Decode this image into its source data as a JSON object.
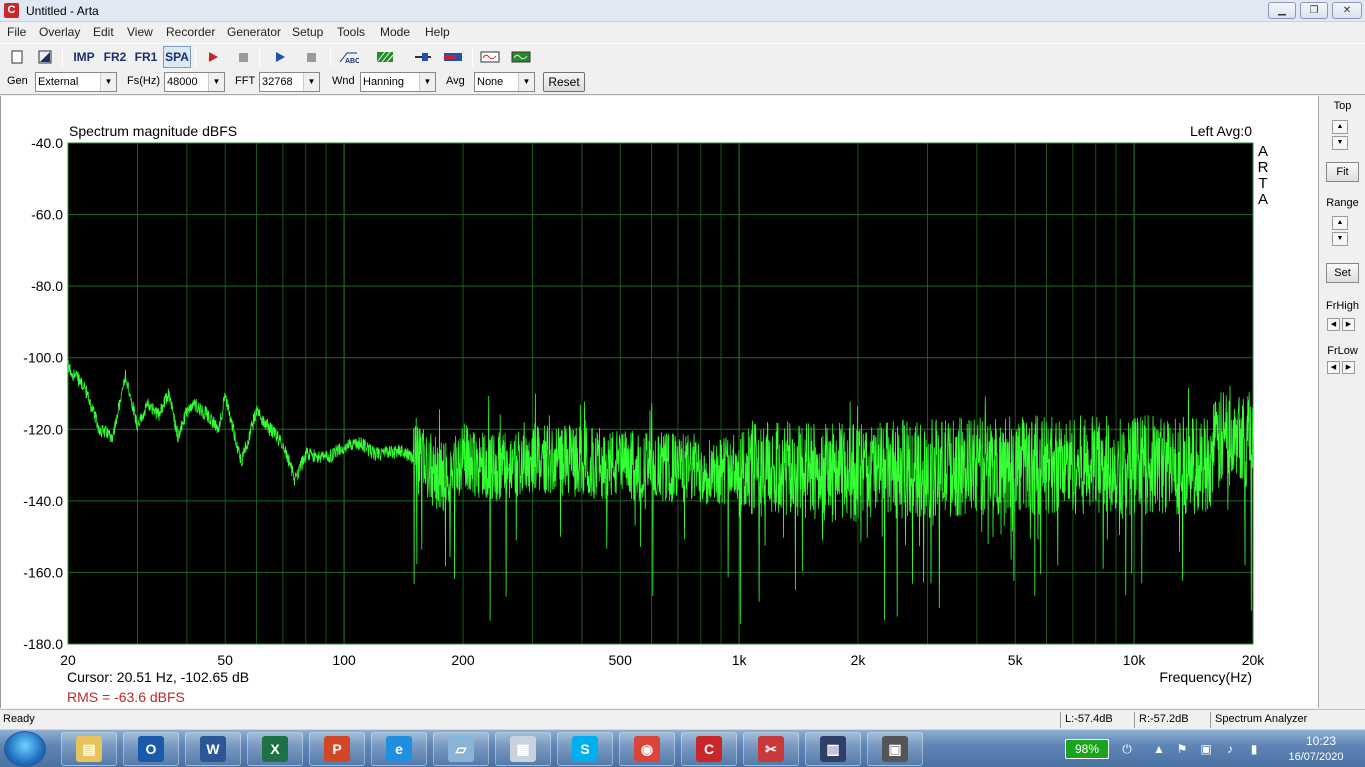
{
  "window": {
    "title": "Untitled - Arta",
    "icon_letter": "C"
  },
  "menu": [
    "File",
    "Overlay",
    "Edit",
    "View",
    "Recorder",
    "Generator",
    "Setup",
    "Tools",
    "Mode",
    "Help"
  ],
  "toolbar": {
    "imp_label": "IMP",
    "fr2_label": "FR2",
    "fr1_label": "FR1",
    "spa_label": "SPA"
  },
  "params": {
    "gen_label": "Gen",
    "gen_value": "External",
    "fs_label": "Fs(Hz)",
    "fs_value": "48000",
    "fft_label": "FFT",
    "fft_value": "32768",
    "wnd_label": "Wnd",
    "wnd_value": "Hanning",
    "avg_label": "Avg",
    "avg_value": "None",
    "reset_label": "Reset"
  },
  "right_panel": {
    "top_label": "Top",
    "fit_label": "Fit",
    "range_label": "Range",
    "set_label": "Set",
    "frhigh_label": "FrHigh",
    "frlow_label": "FrLow"
  },
  "plot": {
    "title": "Spectrum magnitude dBFS",
    "channel_info": "Left  Avg:0",
    "watermark": [
      "A",
      "R",
      "T",
      "A"
    ],
    "cursor_text": "Cursor: 20.51 Hz, -102.65 dB",
    "rms_text": "RMS =  -63.6 dBFS",
    "xlabel": "Frequency(Hz)",
    "bg_color": "#000000",
    "grid_color": "#1f6b1f",
    "trace_color": "#33ff33",
    "rms_color": "#c0262a"
  },
  "chart_data": {
    "type": "line",
    "title": "Spectrum magnitude dBFS",
    "xlabel": "Frequency(Hz)",
    "ylabel": "",
    "x_scale": "log",
    "xlim": [
      20,
      20000
    ],
    "ylim": [
      -180,
      -40
    ],
    "y_ticks": [
      "-40.0",
      "-60.0",
      "-80.0",
      "-100.0",
      "-120.0",
      "-140.0",
      "-160.0",
      "-180.0"
    ],
    "y_tick_values": [
      -40,
      -60,
      -80,
      -100,
      -120,
      -140,
      -160,
      -180
    ],
    "x_ticks": [
      "20",
      "50",
      "100",
      "200",
      "500",
      "1k",
      "2k",
      "5k",
      "10k",
      "20k"
    ],
    "x_tick_values": [
      20,
      50,
      100,
      200,
      500,
      1000,
      2000,
      5000,
      10000,
      20000
    ],
    "grid": true,
    "series": [
      {
        "x": [
          20,
          22,
          24,
          26,
          28,
          30,
          32,
          34,
          36,
          38,
          40,
          42,
          45,
          48,
          50,
          55,
          60,
          65,
          70,
          75,
          80,
          90,
          100,
          110,
          120,
          140,
          160,
          180,
          200,
          250,
          300,
          400,
          500,
          700,
          1000,
          1500,
          2000,
          3000,
          5000,
          7000,
          10000,
          15000,
          18000,
          20000
        ],
        "y": [
          -102.7,
          -108,
          -120,
          -122,
          -105,
          -119,
          -113,
          -116,
          -110,
          -122,
          -115,
          -113,
          -116,
          -120,
          -111,
          -129,
          -115,
          -120,
          -124,
          -134,
          -127,
          -128,
          -125,
          -124,
          -127,
          -126,
          -130,
          -134,
          -128,
          -131,
          -128,
          -129,
          -130,
          -131,
          -131,
          -132,
          -132,
          -131,
          -130,
          -130,
          -130,
          -130,
          -118,
          -125
        ]
      }
    ]
  },
  "status": {
    "ready": "Ready",
    "left_level": "L:-57.4dB",
    "right_level": "R:-57.2dB",
    "mode": "Spectrum Analyzer"
  },
  "taskbar": {
    "battery": "98%",
    "time": "10:23",
    "date": "16/07/2020",
    "apps": [
      {
        "name": "file-explorer",
        "glyph": "▤",
        "color": "#e8c35a"
      },
      {
        "name": "outlook",
        "glyph": "O",
        "color": "#1a5aa8"
      },
      {
        "name": "word",
        "glyph": "W",
        "color": "#2b5797"
      },
      {
        "name": "excel",
        "glyph": "X",
        "color": "#1e7145"
      },
      {
        "name": "powerpoint",
        "glyph": "P",
        "color": "#d24726"
      },
      {
        "name": "internet-explorer",
        "glyph": "e",
        "color": "#1f8fe0"
      },
      {
        "name": "notepad",
        "glyph": "▱",
        "color": "#8ab4d6"
      },
      {
        "name": "calculator",
        "glyph": "▦",
        "color": "#c9d3de"
      },
      {
        "name": "skype",
        "glyph": "S",
        "color": "#00aff0"
      },
      {
        "name": "chrome",
        "glyph": "◉",
        "color": "#db4437"
      },
      {
        "name": "ccleaner",
        "glyph": "C",
        "color": "#c8262a"
      },
      {
        "name": "arta",
        "glyph": "✂",
        "color": "#c83a3a"
      },
      {
        "name": "audio-meter",
        "glyph": "▥",
        "color": "#2f3f6a"
      },
      {
        "name": "network-app",
        "glyph": "▣",
        "color": "#555"
      }
    ]
  }
}
